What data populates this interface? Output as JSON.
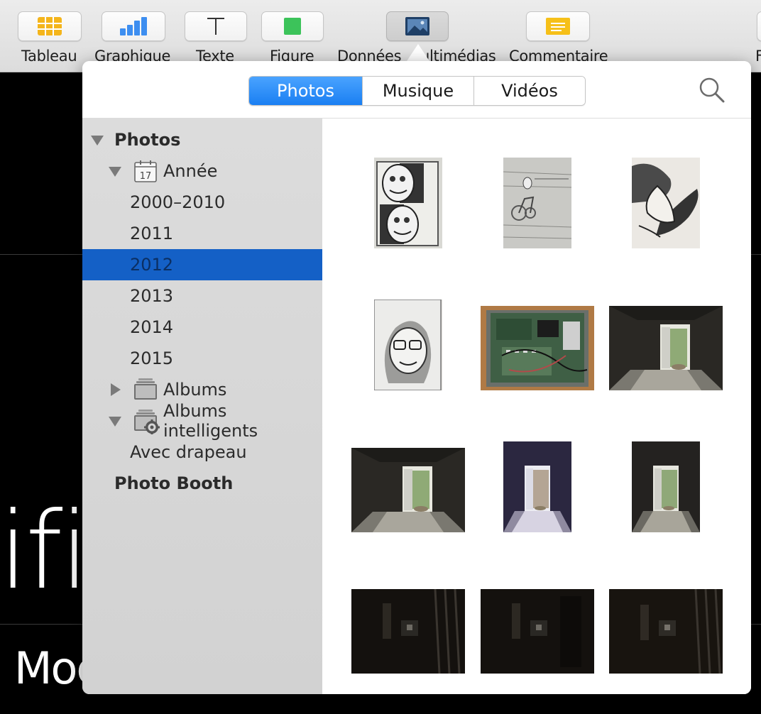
{
  "toolbar": {
    "items": [
      {
        "label": "Tableau",
        "icon": "table-icon"
      },
      {
        "label": "Graphique",
        "icon": "chart-icon"
      },
      {
        "label": "Texte",
        "icon": "text-icon"
      },
      {
        "label": "Figure",
        "icon": "shape-icon"
      },
      {
        "label": "Données",
        "icon": ""
      },
      {
        "label": "ultimédias",
        "icon": "media-icon"
      },
      {
        "label": "Commentaire",
        "icon": "comment-icon"
      },
      {
        "label": "F",
        "icon": ""
      }
    ]
  },
  "document": {
    "big_text": "ific",
    "sub_text": "Moc"
  },
  "popover": {
    "tabs": [
      {
        "label": "Photos",
        "selected": true
      },
      {
        "label": "Musique",
        "selected": false
      },
      {
        "label": "Vidéos",
        "selected": false
      }
    ],
    "search_icon": "search-icon"
  },
  "sidebar": {
    "photos": "Photos",
    "annee": "Année",
    "calendar_day": "17",
    "years": [
      "2000–2010",
      "2011",
      "2012",
      "2013",
      "2014",
      "2015"
    ],
    "selected_year": "2012",
    "albums": "Albums",
    "smart_albums": "Albums intelligents",
    "flagged": "Avec drapeau",
    "photo_booth": "Photo Booth"
  },
  "grid": {
    "thumbnails": [
      "sketch-faces",
      "sketch-cyclist",
      "sketch-hat",
      "sketch-portrait",
      "circuit-board",
      "cellar-doorway",
      "cellar-doorway",
      "cellar-doorway-purple",
      "cellar-doorway",
      "dark-cellar-bars",
      "dark-cellar-bars",
      "dark-cellar-bars"
    ]
  }
}
